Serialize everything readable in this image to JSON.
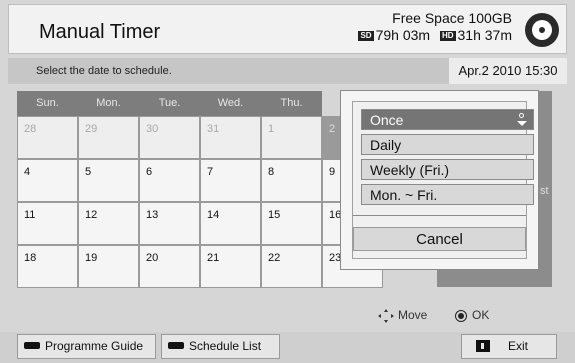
{
  "header": {
    "title": "Manual Timer",
    "free_space": "Free Space 100GB",
    "sd_label": "SD",
    "sd_time": "79h 03m",
    "hd_label": "HD",
    "hd_time": "31h 37m"
  },
  "subbar": {
    "instruction": "Select the date to schedule.",
    "current_date": "Apr.2 2010 15:30"
  },
  "calendar": {
    "weekdays": [
      "Sun.",
      "Mon.",
      "Tue.",
      "Wed.",
      "Thu."
    ],
    "weeks": [
      [
        "28",
        "29",
        "30",
        "31",
        "1",
        "2"
      ],
      [
        "4",
        "5",
        "6",
        "7",
        "8",
        "9"
      ],
      [
        "11",
        "12",
        "13",
        "14",
        "15",
        "16"
      ],
      [
        "18",
        "19",
        "20",
        "21",
        "22",
        "23"
      ]
    ],
    "side_text": "st"
  },
  "popup": {
    "options": [
      "Once",
      "Daily",
      "Weekly (Fri.)",
      "Mon. ~ Fri."
    ],
    "selected": "Once",
    "cancel_label": "Cancel"
  },
  "hints": {
    "move": "Move",
    "ok": "OK"
  },
  "footer": {
    "programme_guide": "Programme Guide",
    "schedule_list": "Schedule List",
    "exit": "Exit"
  }
}
